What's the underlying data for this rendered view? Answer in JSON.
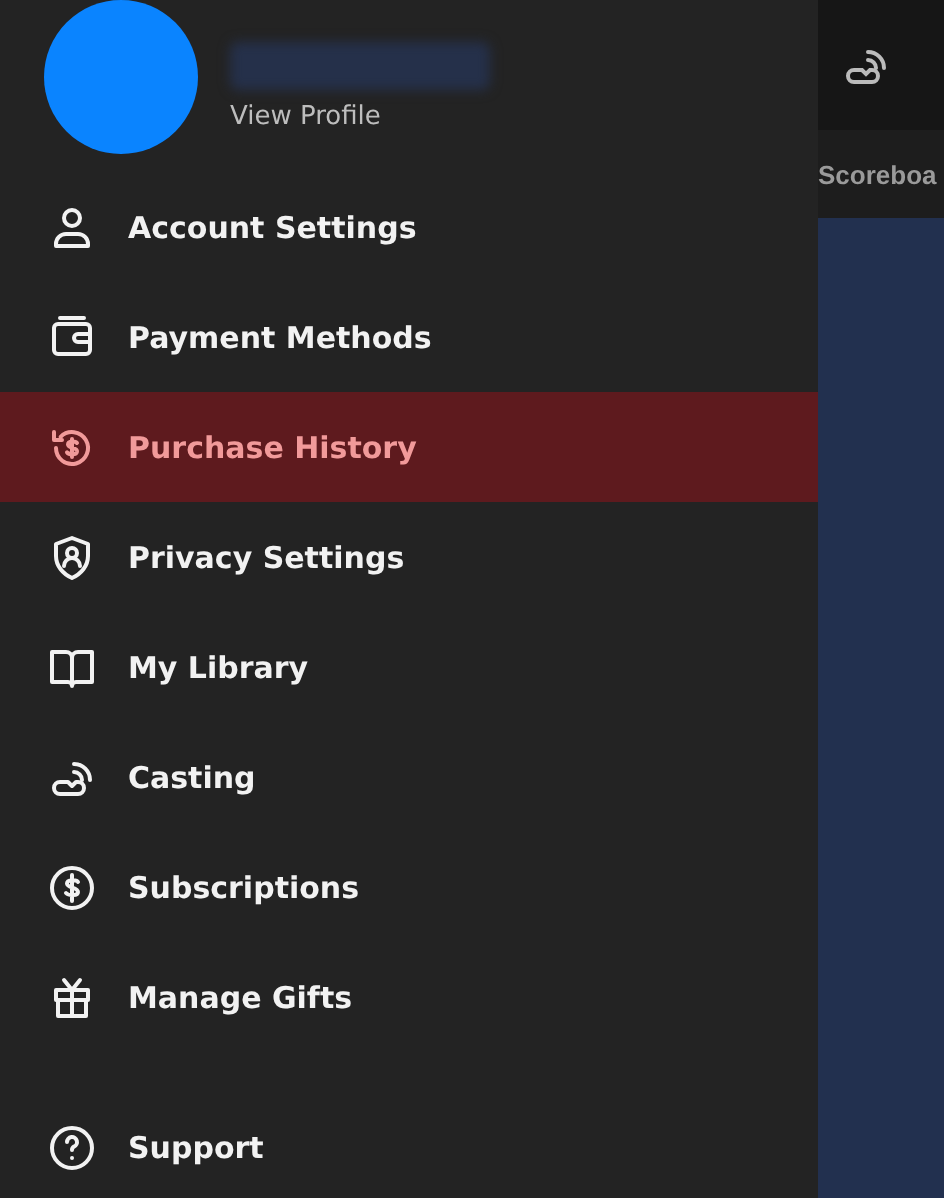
{
  "profile": {
    "link": "View Profile"
  },
  "menu": [
    {
      "label": "Account Settings",
      "selected": false
    },
    {
      "label": "Payment Methods",
      "selected": false
    },
    {
      "label": "Purchase History",
      "selected": true
    },
    {
      "label": "Privacy Settings",
      "selected": false
    },
    {
      "label": "My Library",
      "selected": false
    },
    {
      "label": "Casting",
      "selected": false
    },
    {
      "label": "Subscriptions",
      "selected": false
    },
    {
      "label": "Manage Gifts",
      "selected": false
    }
  ],
  "secondary_menu": [
    {
      "label": "Support",
      "selected": false
    }
  ],
  "background": {
    "tab": "Scoreboa"
  }
}
